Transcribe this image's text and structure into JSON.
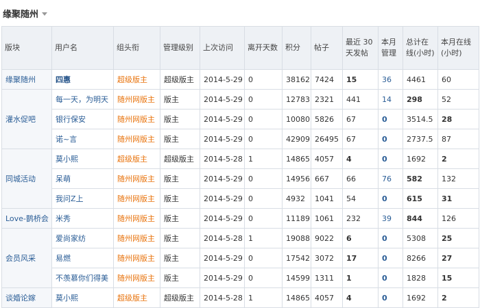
{
  "page": {
    "title": "缘聚随州"
  },
  "table": {
    "headers": [
      "版块",
      "用户名",
      "组头衔",
      "管理级别",
      "上次访问",
      "离开天数",
      "积分",
      "帖子",
      "最近 30 天发帖",
      "本月管理",
      "总计在线(小时)",
      "本月在线(小时)"
    ],
    "sections": [
      {
        "name": "缘聚随州",
        "rows": [
          {
            "user": "四惠",
            "user_bold": true,
            "group": "超级版主",
            "group_type": "super",
            "level": "超级版主",
            "last": "2014-5-29",
            "days": "0",
            "points": "38162",
            "posts": "7424",
            "recent": "15",
            "recent_bold": true,
            "manage": "36",
            "manage_blue": true,
            "total": "4461",
            "total_bold": false,
            "month": "60",
            "month_bold": false
          }
        ]
      },
      {
        "name": "灌水促吧",
        "rows": [
          {
            "user": "每一天，为明天",
            "group": "随州网版主",
            "group_type": "board",
            "level": "版主",
            "last": "2014-5-29",
            "days": "0",
            "points": "12783",
            "posts": "2321",
            "recent": "441",
            "manage": "14",
            "manage_blue": true,
            "total": "298",
            "total_bold": true,
            "month": "52"
          },
          {
            "user": "银行保安",
            "group": "随州网版主",
            "group_type": "board",
            "level": "版主",
            "last": "2014-5-29",
            "days": "0",
            "points": "10080",
            "posts": "5826",
            "recent": "67",
            "manage": "0",
            "total": "3514.5",
            "month": "28",
            "month_bold": true
          },
          {
            "user": "诺~言",
            "group": "随州网版主",
            "group_type": "board",
            "level": "版主",
            "last": "2014-5-29",
            "days": "0",
            "points": "42909",
            "posts": "26495",
            "recent": "67",
            "manage": "0",
            "total": "2737.5",
            "month": "87"
          }
        ]
      },
      {
        "name": "同城活动",
        "rows": [
          {
            "user": "莫小熙",
            "group": "超级版主",
            "group_type": "super",
            "level": "超级版主",
            "last": "2014-5-28",
            "days": "1",
            "points": "14865",
            "posts": "4057",
            "recent": "4",
            "recent_bold": true,
            "manage": "0",
            "total": "1692",
            "month": "2",
            "month_bold": true
          },
          {
            "user": "呆萌",
            "group": "随州网版主",
            "group_type": "board",
            "level": "版主",
            "last": "2014-5-29",
            "days": "0",
            "points": "14956",
            "posts": "667",
            "recent": "66",
            "manage": "76",
            "manage_blue": true,
            "total": "582",
            "total_bold": true,
            "month": "132"
          },
          {
            "user": "我问Z上",
            "group": "随州网版主",
            "group_type": "board",
            "level": "版主",
            "last": "2014-5-29",
            "days": "0",
            "points": "4932",
            "posts": "1041",
            "recent": "54",
            "manage": "0",
            "total": "615",
            "total_bold": true,
            "month": "31",
            "month_bold": true
          }
        ]
      },
      {
        "name": "Love-鹊桥会",
        "rows": [
          {
            "user": "米秀",
            "group": "随州网版主",
            "group_type": "board",
            "level": "版主",
            "last": "2014-5-29",
            "days": "0",
            "points": "11189",
            "posts": "1061",
            "recent": "232",
            "manage": "39",
            "manage_blue": true,
            "total": "844",
            "total_bold": true,
            "month": "126"
          }
        ]
      },
      {
        "name": "会员风采",
        "rows": [
          {
            "user": "爱尚家纺",
            "group": "随州网版主",
            "group_type": "board",
            "level": "版主",
            "last": "2014-5-28",
            "days": "1",
            "points": "19088",
            "posts": "9022",
            "recent": "6",
            "recent_bold": true,
            "manage": "0",
            "total": "5308",
            "month": "25",
            "month_bold": true
          },
          {
            "user": "易燃",
            "group": "随州网版主",
            "group_type": "board",
            "level": "版主",
            "last": "2014-5-29",
            "days": "0",
            "points": "17542",
            "posts": "3072",
            "recent": "17",
            "recent_bold": true,
            "manage": "0",
            "total": "8266",
            "month": "27",
            "month_bold": true
          },
          {
            "user": "不羡慕你们得美",
            "group": "随州网版主",
            "group_type": "board",
            "level": "版主",
            "last": "2014-5-29",
            "days": "0",
            "points": "14599",
            "posts": "1311",
            "recent": "1",
            "recent_bold": true,
            "manage": "0",
            "total": "1828",
            "month": "15",
            "month_bold": true
          }
        ]
      },
      {
        "name": "谈婚论嫁",
        "rows": [
          {
            "user": "莫小熙",
            "group": "超级版主",
            "group_type": "super",
            "level": "超级版主",
            "last": "2014-5-28",
            "days": "1",
            "points": "14865",
            "posts": "4057",
            "recent": "4",
            "recent_bold": true,
            "manage": "0",
            "total": "1692",
            "month": "2",
            "month_bold": true
          }
        ]
      }
    ]
  }
}
